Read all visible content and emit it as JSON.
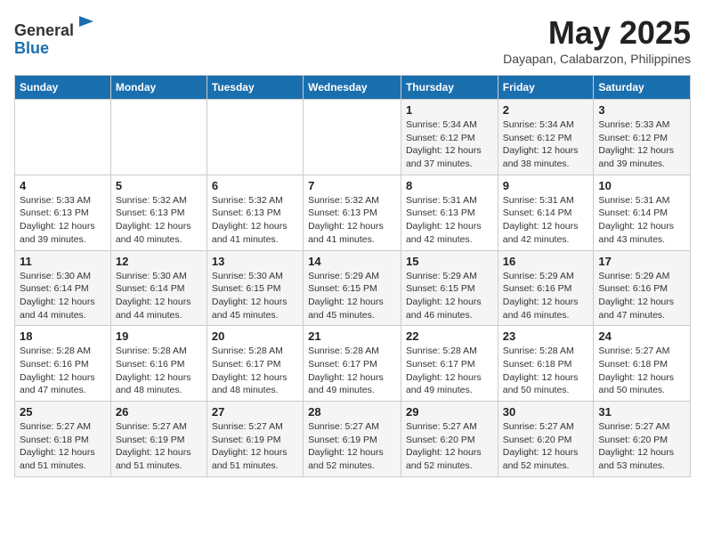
{
  "header": {
    "logo_general": "General",
    "logo_blue": "Blue",
    "month_title": "May 2025",
    "subtitle": "Dayapan, Calabarzon, Philippines"
  },
  "days_of_week": [
    "Sunday",
    "Monday",
    "Tuesday",
    "Wednesday",
    "Thursday",
    "Friday",
    "Saturday"
  ],
  "weeks": [
    [
      {
        "day": "",
        "info": ""
      },
      {
        "day": "",
        "info": ""
      },
      {
        "day": "",
        "info": ""
      },
      {
        "day": "",
        "info": ""
      },
      {
        "day": "1",
        "info": "Sunrise: 5:34 AM\nSunset: 6:12 PM\nDaylight: 12 hours\nand 37 minutes."
      },
      {
        "day": "2",
        "info": "Sunrise: 5:34 AM\nSunset: 6:12 PM\nDaylight: 12 hours\nand 38 minutes."
      },
      {
        "day": "3",
        "info": "Sunrise: 5:33 AM\nSunset: 6:12 PM\nDaylight: 12 hours\nand 39 minutes."
      }
    ],
    [
      {
        "day": "4",
        "info": "Sunrise: 5:33 AM\nSunset: 6:13 PM\nDaylight: 12 hours\nand 39 minutes."
      },
      {
        "day": "5",
        "info": "Sunrise: 5:32 AM\nSunset: 6:13 PM\nDaylight: 12 hours\nand 40 minutes."
      },
      {
        "day": "6",
        "info": "Sunrise: 5:32 AM\nSunset: 6:13 PM\nDaylight: 12 hours\nand 41 minutes."
      },
      {
        "day": "7",
        "info": "Sunrise: 5:32 AM\nSunset: 6:13 PM\nDaylight: 12 hours\nand 41 minutes."
      },
      {
        "day": "8",
        "info": "Sunrise: 5:31 AM\nSunset: 6:13 PM\nDaylight: 12 hours\nand 42 minutes."
      },
      {
        "day": "9",
        "info": "Sunrise: 5:31 AM\nSunset: 6:14 PM\nDaylight: 12 hours\nand 42 minutes."
      },
      {
        "day": "10",
        "info": "Sunrise: 5:31 AM\nSunset: 6:14 PM\nDaylight: 12 hours\nand 43 minutes."
      }
    ],
    [
      {
        "day": "11",
        "info": "Sunrise: 5:30 AM\nSunset: 6:14 PM\nDaylight: 12 hours\nand 44 minutes."
      },
      {
        "day": "12",
        "info": "Sunrise: 5:30 AM\nSunset: 6:14 PM\nDaylight: 12 hours\nand 44 minutes."
      },
      {
        "day": "13",
        "info": "Sunrise: 5:30 AM\nSunset: 6:15 PM\nDaylight: 12 hours\nand 45 minutes."
      },
      {
        "day": "14",
        "info": "Sunrise: 5:29 AM\nSunset: 6:15 PM\nDaylight: 12 hours\nand 45 minutes."
      },
      {
        "day": "15",
        "info": "Sunrise: 5:29 AM\nSunset: 6:15 PM\nDaylight: 12 hours\nand 46 minutes."
      },
      {
        "day": "16",
        "info": "Sunrise: 5:29 AM\nSunset: 6:16 PM\nDaylight: 12 hours\nand 46 minutes."
      },
      {
        "day": "17",
        "info": "Sunrise: 5:29 AM\nSunset: 6:16 PM\nDaylight: 12 hours\nand 47 minutes."
      }
    ],
    [
      {
        "day": "18",
        "info": "Sunrise: 5:28 AM\nSunset: 6:16 PM\nDaylight: 12 hours\nand 47 minutes."
      },
      {
        "day": "19",
        "info": "Sunrise: 5:28 AM\nSunset: 6:16 PM\nDaylight: 12 hours\nand 48 minutes."
      },
      {
        "day": "20",
        "info": "Sunrise: 5:28 AM\nSunset: 6:17 PM\nDaylight: 12 hours\nand 48 minutes."
      },
      {
        "day": "21",
        "info": "Sunrise: 5:28 AM\nSunset: 6:17 PM\nDaylight: 12 hours\nand 49 minutes."
      },
      {
        "day": "22",
        "info": "Sunrise: 5:28 AM\nSunset: 6:17 PM\nDaylight: 12 hours\nand 49 minutes."
      },
      {
        "day": "23",
        "info": "Sunrise: 5:28 AM\nSunset: 6:18 PM\nDaylight: 12 hours\nand 50 minutes."
      },
      {
        "day": "24",
        "info": "Sunrise: 5:27 AM\nSunset: 6:18 PM\nDaylight: 12 hours\nand 50 minutes."
      }
    ],
    [
      {
        "day": "25",
        "info": "Sunrise: 5:27 AM\nSunset: 6:18 PM\nDaylight: 12 hours\nand 51 minutes."
      },
      {
        "day": "26",
        "info": "Sunrise: 5:27 AM\nSunset: 6:19 PM\nDaylight: 12 hours\nand 51 minutes."
      },
      {
        "day": "27",
        "info": "Sunrise: 5:27 AM\nSunset: 6:19 PM\nDaylight: 12 hours\nand 51 minutes."
      },
      {
        "day": "28",
        "info": "Sunrise: 5:27 AM\nSunset: 6:19 PM\nDaylight: 12 hours\nand 52 minutes."
      },
      {
        "day": "29",
        "info": "Sunrise: 5:27 AM\nSunset: 6:20 PM\nDaylight: 12 hours\nand 52 minutes."
      },
      {
        "day": "30",
        "info": "Sunrise: 5:27 AM\nSunset: 6:20 PM\nDaylight: 12 hours\nand 52 minutes."
      },
      {
        "day": "31",
        "info": "Sunrise: 5:27 AM\nSunset: 6:20 PM\nDaylight: 12 hours\nand 53 minutes."
      }
    ]
  ]
}
